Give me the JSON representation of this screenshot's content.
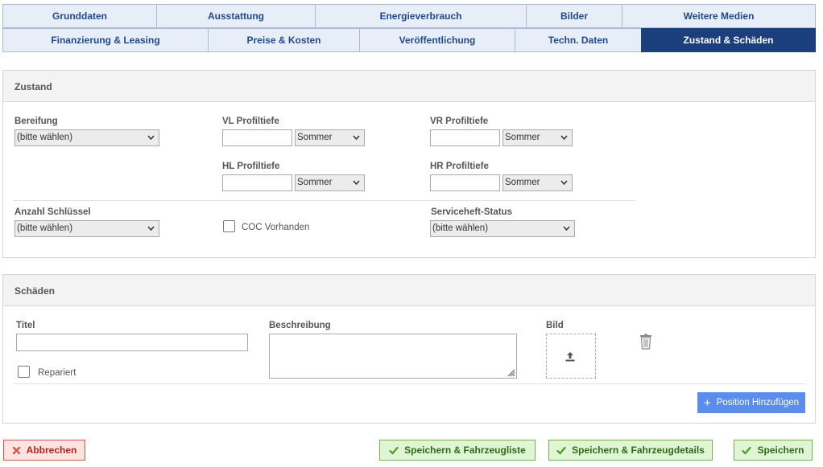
{
  "tabs_row1": [
    "Grunddaten",
    "Ausstattung",
    "Energieverbrauch",
    "Bilder",
    "Weitere Medien"
  ],
  "tabs_row2": [
    "Finanzierung & Leasing",
    "Preise & Kosten",
    "Veröffentlichung",
    "Techn. Daten",
    "Zustand & Schäden"
  ],
  "active_tab": "Zustand & Schäden",
  "zustand": {
    "title": "Zustand",
    "bereifung_label": "Bereifung",
    "bereifung_value": "(bitte wählen)",
    "vl_label": "VL Profiltiefe",
    "vl_season": "Sommer",
    "vr_label": "VR Profiltiefe",
    "vr_season": "Sommer",
    "hl_label": "HL Profiltiefe",
    "hl_season": "Sommer",
    "hr_label": "HR Profiltiefe",
    "hr_season": "Sommer",
    "schluessel_label": "Anzahl Schlüssel",
    "schluessel_value": "(bitte wählen)",
    "coc_label": "COC Vorhanden",
    "service_label": "Serviceheft-Status",
    "service_value": "(bitte wählen)"
  },
  "schaeden": {
    "title": "Schäden",
    "titel_label": "Titel",
    "titel_value": "",
    "beschreibung_label": "Beschreibung",
    "bild_label": "Bild",
    "repariert_label": "Repariert",
    "add_button": "Position Hinzufügen"
  },
  "footer": {
    "cancel": "Abbrechen",
    "save_list": "Speichern & Fahrzeugliste",
    "save_details": "Speichern & Fahrzeugdetails",
    "save": "Speichern"
  },
  "colors": {
    "tab_active": "#1b3f7c",
    "tab_bg": "#e8eef8",
    "save_green": "#dff5d3",
    "cancel_red": "#fde4e0",
    "add_blue": "#5b8ded"
  }
}
